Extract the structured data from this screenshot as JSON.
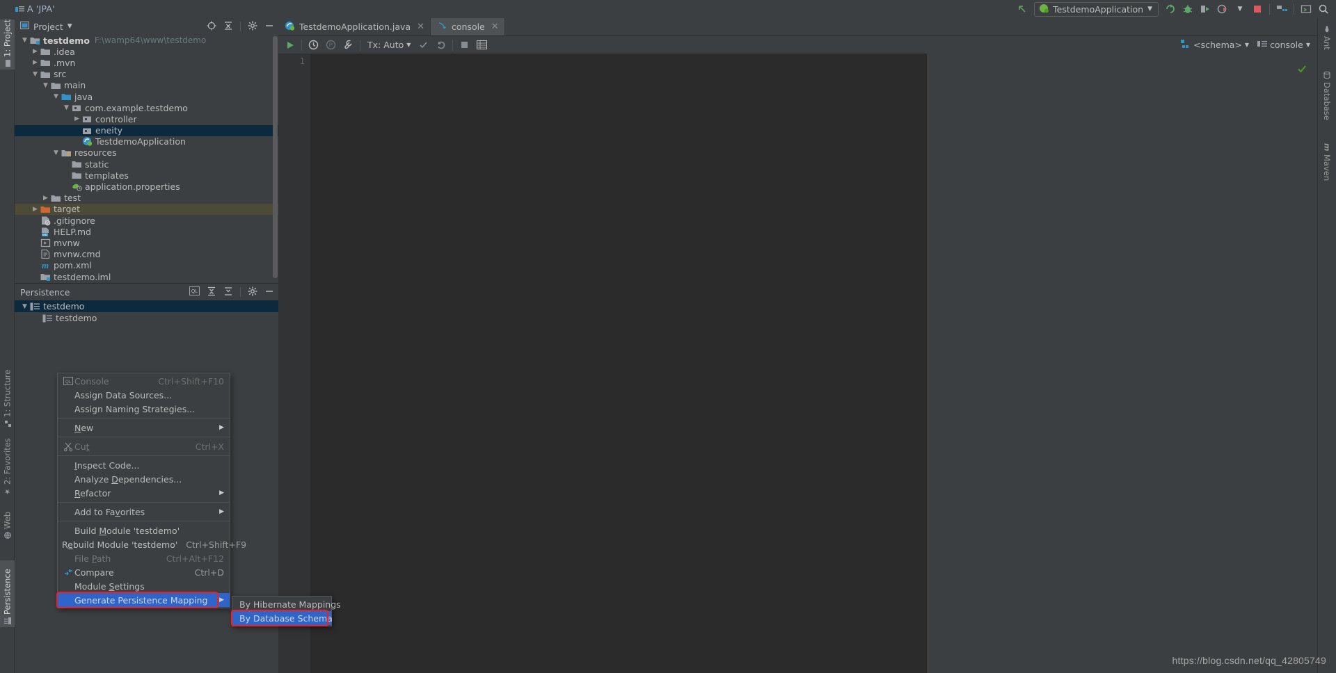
{
  "window": {
    "title": "A 'JPA'",
    "watermark": "https://blog.csdn.net/qq_42805749"
  },
  "titlebar_right": {
    "run_config": "TestdemoApplication",
    "icons": [
      "back-arrow-icon",
      "spring-icon",
      "chevron-down-icon",
      "rerun-icon",
      "debug-icon",
      "run-with-coverage-icon",
      "profiler-icon",
      "stop-icon",
      "project-structure-icon",
      "terminal-icon",
      "search-everywhere-icon"
    ]
  },
  "left_strip": {
    "tabs": [
      {
        "label": "1: Project",
        "icon": "project-icon",
        "active": true
      },
      {
        "label": "1: Structure",
        "icon": "structure-icon",
        "active": false
      },
      {
        "label": "2: Favorites",
        "icon": "star-icon",
        "active": false
      },
      {
        "label": "Web",
        "icon": "web-icon",
        "active": false
      },
      {
        "label": "Persistence",
        "icon": "persistence-icon",
        "active": true
      }
    ]
  },
  "right_strip": {
    "tabs": [
      {
        "label": "Ant",
        "icon": "ant-icon"
      },
      {
        "label": "Database",
        "icon": "database-icon"
      },
      {
        "label": "Maven",
        "icon": "maven-icon"
      }
    ]
  },
  "project_panel": {
    "title": "Project",
    "dropdown_icon": "chevron-down-icon",
    "actions": [
      "locate-icon",
      "collapse-all-icon",
      "settings-gear-icon",
      "hide-icon"
    ],
    "tree": [
      {
        "depth": 0,
        "twig": "v",
        "icon": "module-icon",
        "label": "testdemo",
        "bold": true,
        "path": "F:\\wamp64\\www\\testdemo",
        "state": ""
      },
      {
        "depth": 1,
        "twig": ">",
        "icon": "folder-icon",
        "label": ".idea",
        "state": ""
      },
      {
        "depth": 1,
        "twig": ">",
        "icon": "folder-icon",
        "label": ".mvn",
        "state": ""
      },
      {
        "depth": 1,
        "twig": "v",
        "icon": "folder-icon",
        "label": "src",
        "state": ""
      },
      {
        "depth": 2,
        "twig": "v",
        "icon": "folder-icon",
        "label": "main",
        "state": ""
      },
      {
        "depth": 3,
        "twig": "v",
        "icon": "source-root-icon",
        "label": "java",
        "state": ""
      },
      {
        "depth": 4,
        "twig": "v",
        "icon": "package-icon",
        "label": "com.example.testdemo",
        "state": ""
      },
      {
        "depth": 5,
        "twig": ">",
        "icon": "package-icon",
        "label": "controller",
        "state": ""
      },
      {
        "depth": 5,
        "twig": "",
        "icon": "package-icon",
        "label": "eneity",
        "state": "sel"
      },
      {
        "depth": 5,
        "twig": "",
        "icon": "spring-class-icon",
        "label": "TestdemoApplication",
        "state": ""
      },
      {
        "depth": 3,
        "twig": "v",
        "icon": "resources-root-icon",
        "label": "resources",
        "state": ""
      },
      {
        "depth": 4,
        "twig": "",
        "icon": "folder-icon",
        "label": "static",
        "state": ""
      },
      {
        "depth": 4,
        "twig": "",
        "icon": "folder-icon",
        "label": "templates",
        "state": ""
      },
      {
        "depth": 4,
        "twig": "",
        "icon": "properties-icon",
        "label": "application.properties",
        "state": ""
      },
      {
        "depth": 2,
        "twig": ">",
        "icon": "folder-icon",
        "label": "test",
        "state": ""
      },
      {
        "depth": 1,
        "twig": ">",
        "icon": "excluded-folder-icon",
        "label": "target",
        "state": "sel-dim"
      },
      {
        "depth": 1,
        "twig": "",
        "icon": "gitignore-icon",
        "label": ".gitignore",
        "state": ""
      },
      {
        "depth": 1,
        "twig": "",
        "icon": "markdown-icon",
        "label": "HELP.md",
        "state": ""
      },
      {
        "depth": 1,
        "twig": "",
        "icon": "script-icon",
        "label": "mvnw",
        "state": ""
      },
      {
        "depth": 1,
        "twig": "",
        "icon": "cmd-icon",
        "label": "mvnw.cmd",
        "state": ""
      },
      {
        "depth": 1,
        "twig": "",
        "icon": "maven-pom-icon",
        "label": "pom.xml",
        "state": ""
      },
      {
        "depth": 1,
        "twig": "",
        "icon": "iml-icon",
        "label": "testdemo.iml",
        "state": ""
      }
    ]
  },
  "persistence_panel": {
    "title": "Persistence",
    "actions": [
      "console-ql-icon",
      "expand-all-icon",
      "collapse-all-icon",
      "settings-gear-icon",
      "hide-icon"
    ],
    "tree": [
      {
        "depth": 0,
        "twig": "v",
        "icon": "persistence-unit-icon",
        "label": "testdemo",
        "state": "sel"
      },
      {
        "depth": 1,
        "twig": "",
        "icon": "persistence-unit-icon",
        "label": "testdemo",
        "state": ""
      }
    ]
  },
  "editor": {
    "tabs": [
      {
        "label": "TestdemoApplication.java",
        "icon": "spring-class-icon",
        "active": false,
        "closable": true
      },
      {
        "label": "console",
        "icon": "console-tab-icon",
        "active": true,
        "closable": true
      }
    ],
    "toolbar": {
      "run_icon": "run-icon",
      "history_icon": "history-icon",
      "pause_icon": "pin-icon",
      "wrench_icon": "wrench-icon",
      "tx_label": "Tx: Auto",
      "tx_chevron": "chevron-down-icon",
      "commit_icon": "commit-check-icon",
      "rollback_icon": "rollback-icon",
      "stop_icon": "stop-icon",
      "table_icon": "table-icon",
      "schema_label": "<schema>",
      "schema_icon": "schema-icon",
      "console_label": "console",
      "console_icon": "console-select-icon"
    },
    "line_number": "1",
    "status_ok_icon": "check-icon"
  },
  "context_menu": {
    "items": [
      {
        "icon": "console-ql-icon",
        "label": "Console",
        "shortcut": "Ctrl+Shift+F10",
        "disabled": true,
        "arrow": false
      },
      {
        "icon": "",
        "label": "Assign Data Sources...",
        "shortcut": "",
        "disabled": false,
        "arrow": false
      },
      {
        "icon": "",
        "label": "Assign Naming Strategies...",
        "shortcut": "",
        "disabled": false,
        "arrow": false
      },
      {
        "separator": true
      },
      {
        "icon": "",
        "label": "New",
        "mnemonic": "N",
        "shortcut": "",
        "disabled": false,
        "arrow": true
      },
      {
        "separator": true
      },
      {
        "icon": "cut-icon",
        "label": "Cut",
        "mnemonic": "t",
        "shortcut": "Ctrl+X",
        "disabled": true,
        "arrow": false
      },
      {
        "separator": true
      },
      {
        "icon": "",
        "label": "Inspect Code...",
        "mnemonic": "I",
        "shortcut": "",
        "disabled": false,
        "arrow": false
      },
      {
        "icon": "",
        "label": "Analyze Dependencies...",
        "mnemonic": "D",
        "shortcut": "",
        "disabled": false,
        "arrow": false
      },
      {
        "icon": "",
        "label": "Refactor",
        "mnemonic": "R",
        "shortcut": "",
        "disabled": false,
        "arrow": true
      },
      {
        "separator": true
      },
      {
        "icon": "",
        "label": "Add to Favorites",
        "mnemonic": "v",
        "shortcut": "",
        "disabled": false,
        "arrow": true
      },
      {
        "separator": true
      },
      {
        "icon": "",
        "label": "Build Module 'testdemo'",
        "mnemonic": "M",
        "shortcut": "",
        "disabled": false,
        "arrow": false
      },
      {
        "icon": "",
        "label": "Rebuild Module 'testdemo'",
        "mnemonic": "e",
        "shortcut": "Ctrl+Shift+F9",
        "disabled": false,
        "arrow": false
      },
      {
        "icon": "",
        "label": "File Path",
        "mnemonic": "P",
        "shortcut": "Ctrl+Alt+F12",
        "disabled": true,
        "arrow": false
      },
      {
        "icon": "compare-icon",
        "label": "Compare",
        "shortcut": "Ctrl+D",
        "disabled": false,
        "arrow": false
      },
      {
        "icon": "",
        "label": "Module Settings",
        "mnemonic": "S",
        "shortcut": "",
        "disabled": false,
        "arrow": false
      },
      {
        "icon": "",
        "label": "Generate Persistence Mapping",
        "shortcut": "",
        "disabled": false,
        "arrow": true,
        "highlight": true,
        "redbox": true
      }
    ]
  },
  "submenu": {
    "items": [
      {
        "label": "By Hibernate Mappings",
        "highlight": false,
        "redbox": false
      },
      {
        "label": "By Database Schema",
        "highlight": true,
        "redbox": true
      }
    ]
  },
  "colors": {
    "bg": "#3c3f41",
    "editor_bg": "#2b2b2b",
    "selection_blue": "#0d293e",
    "menu_highlight": "#2f65ca",
    "redbox": "#ef2020",
    "accent_blue": "#3592c4",
    "folder_gray": "#9aa0a6",
    "target_orange": "#cc6633",
    "green": "#4e9a27"
  }
}
